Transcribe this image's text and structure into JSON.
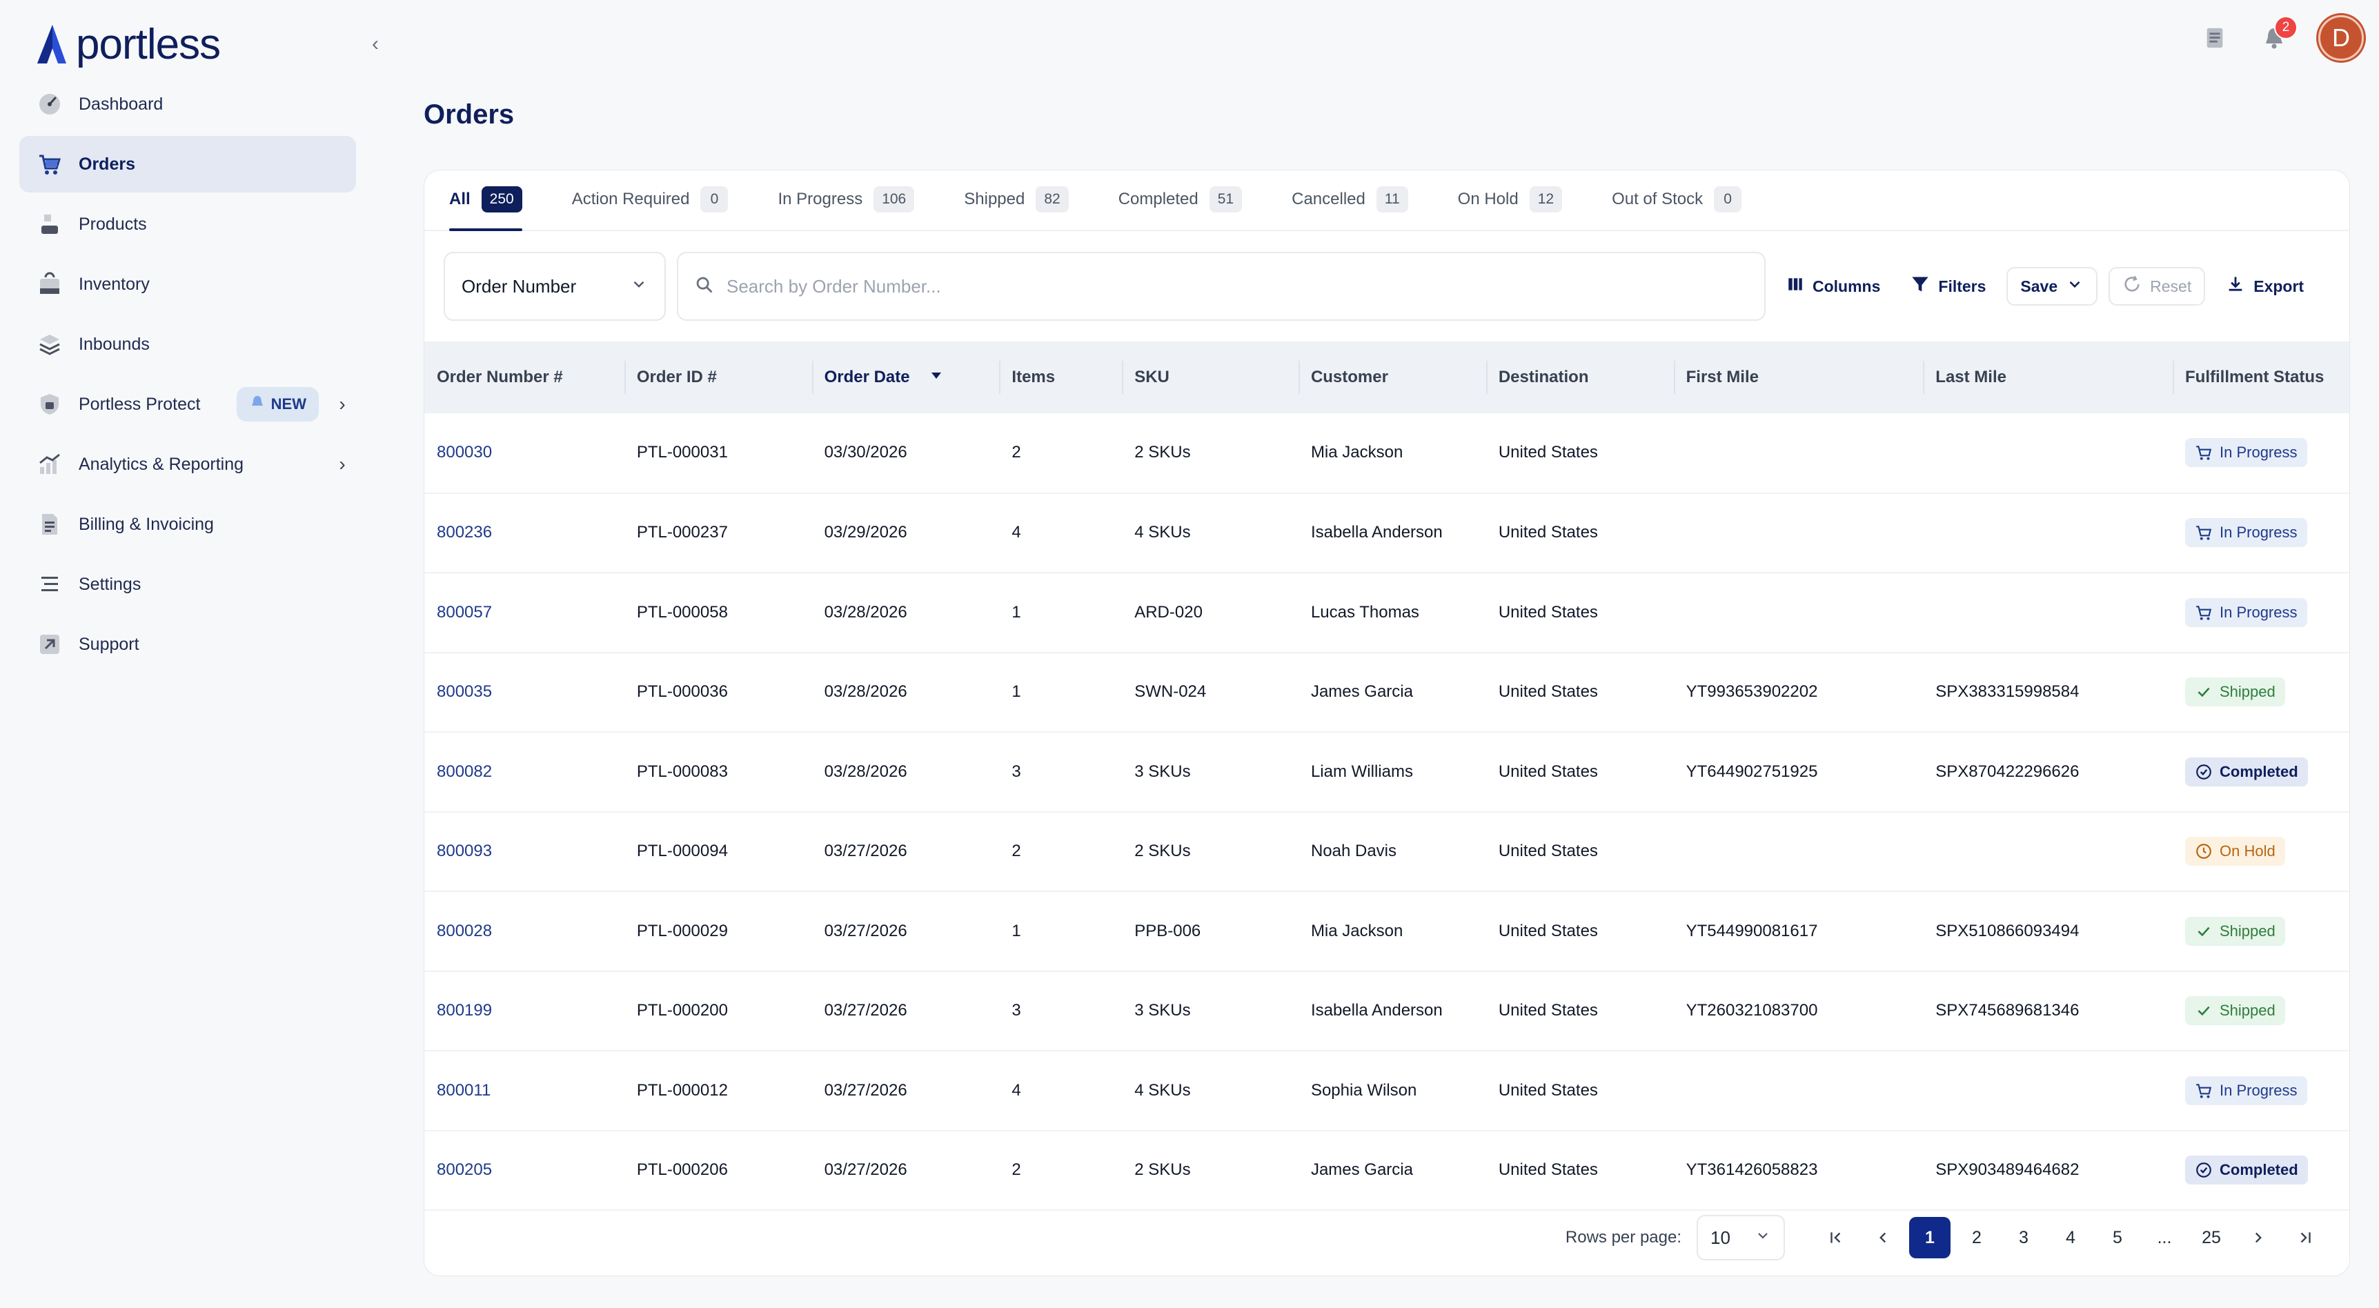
{
  "app": {
    "name": "portless"
  },
  "sidebar": {
    "items": [
      {
        "label": "Dashboard",
        "icon": "dashboard-icon",
        "active": false
      },
      {
        "label": "Orders",
        "icon": "cart-icon",
        "active": true
      },
      {
        "label": "Products",
        "icon": "products-icon",
        "active": false
      },
      {
        "label": "Inventory",
        "icon": "inventory-icon",
        "active": false
      },
      {
        "label": "Inbounds",
        "icon": "inbounds-icon",
        "active": false
      },
      {
        "label": "Portless Protect",
        "icon": "lock-icon",
        "badge": "NEW",
        "chevron": true
      },
      {
        "label": "Analytics & Reporting",
        "icon": "analytics-icon",
        "chevron": true
      },
      {
        "label": "Billing & Invoicing",
        "icon": "billing-icon"
      },
      {
        "label": "Settings",
        "icon": "settings-icon"
      },
      {
        "label": "Support",
        "icon": "support-icon"
      }
    ]
  },
  "topbar": {
    "notification_count": "2",
    "avatar_initial": "D"
  },
  "page": {
    "title": "Orders"
  },
  "tabs": [
    {
      "label": "All",
      "count": "250"
    },
    {
      "label": "Action Required",
      "count": "0"
    },
    {
      "label": "In Progress",
      "count": "106"
    },
    {
      "label": "Shipped",
      "count": "82"
    },
    {
      "label": "Completed",
      "count": "51"
    },
    {
      "label": "Cancelled",
      "count": "11"
    },
    {
      "label": "On Hold",
      "count": "12"
    },
    {
      "label": "Out of Stock",
      "count": "0"
    }
  ],
  "toolbar": {
    "search_field": "Order Number",
    "search_placeholder": "Search by Order Number...",
    "columns_label": "Columns",
    "filters_label": "Filters",
    "save_label": "Save",
    "reset_label": "Reset",
    "export_label": "Export"
  },
  "table": {
    "headers": [
      "Order Number #",
      "Order ID #",
      "Order Date",
      "Items",
      "SKU",
      "Customer",
      "Destination",
      "First Mile",
      "Last Mile",
      "Fulfillment Status"
    ],
    "rows": [
      [
        "800030",
        "PTL-000031",
        "03/30/2026",
        "2",
        "2 SKUs",
        "Mia Jackson",
        "United States",
        "",
        "",
        "In Progress"
      ],
      [
        "800236",
        "PTL-000237",
        "03/29/2026",
        "4",
        "4 SKUs",
        "Isabella Anderson",
        "United States",
        "",
        "",
        "In Progress"
      ],
      [
        "800057",
        "PTL-000058",
        "03/28/2026",
        "1",
        "ARD-020",
        "Lucas Thomas",
        "United States",
        "",
        "",
        "In Progress"
      ],
      [
        "800035",
        "PTL-000036",
        "03/28/2026",
        "1",
        "SWN-024",
        "James Garcia",
        "United States",
        "YT993653902202",
        "SPX383315998584",
        "Shipped"
      ],
      [
        "800082",
        "PTL-000083",
        "03/28/2026",
        "3",
        "3 SKUs",
        "Liam Williams",
        "United States",
        "YT644902751925",
        "SPX870422296626",
        "Completed"
      ],
      [
        "800093",
        "PTL-000094",
        "03/27/2026",
        "2",
        "2 SKUs",
        "Noah Davis",
        "United States",
        "",
        "",
        "On Hold"
      ],
      [
        "800028",
        "PTL-000029",
        "03/27/2026",
        "1",
        "PPB-006",
        "Mia Jackson",
        "United States",
        "YT544990081617",
        "SPX510866093494",
        "Shipped"
      ],
      [
        "800199",
        "PTL-000200",
        "03/27/2026",
        "3",
        "3 SKUs",
        "Isabella Anderson",
        "United States",
        "YT260321083700",
        "SPX745689681346",
        "Shipped"
      ],
      [
        "800011",
        "PTL-000012",
        "03/27/2026",
        "4",
        "4 SKUs",
        "Sophia Wilson",
        "United States",
        "",
        "",
        "In Progress"
      ],
      [
        "800205",
        "PTL-000206",
        "03/27/2026",
        "2",
        "2 SKUs",
        "James Garcia",
        "United States",
        "YT361426058823",
        "SPX903489464682",
        "Completed"
      ]
    ]
  },
  "pagination": {
    "rows_per_page_label": "Rows per page:",
    "rows_per_page": "10",
    "pages": [
      "1",
      "2",
      "3",
      "4",
      "5",
      "...",
      "25"
    ],
    "current": "1"
  },
  "colors": {
    "brand": "#0f1f5c",
    "accent": "#1e3a8a"
  }
}
